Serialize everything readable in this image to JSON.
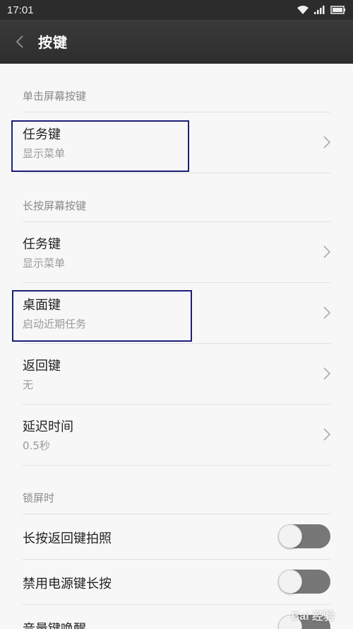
{
  "status_bar": {
    "time": "17:01"
  },
  "header": {
    "title": "按键"
  },
  "sections": {
    "single_tap": {
      "title": "单击屏幕按键",
      "items": [
        {
          "title": "任务键",
          "subtitle": "显示菜单"
        }
      ]
    },
    "long_press": {
      "title": "长按屏幕按键",
      "items": [
        {
          "title": "任务键",
          "subtitle": "显示菜单"
        },
        {
          "title": "桌面键",
          "subtitle": "启动近期任务"
        },
        {
          "title": "返回键",
          "subtitle": "无"
        },
        {
          "title": "延迟时间",
          "subtitle": "0.5秒"
        }
      ]
    },
    "lock_screen": {
      "title": "锁屏时",
      "items": [
        {
          "title": "长按返回键拍照",
          "state": "off"
        },
        {
          "title": "禁用电源键长按",
          "state": "off"
        },
        {
          "title": "音量键唤醒",
          "state": "off"
        }
      ]
    }
  },
  "watermark": "Bai 经验",
  "colors": {
    "highlight": "#1e1e7a",
    "toggle_off": "#777777"
  }
}
